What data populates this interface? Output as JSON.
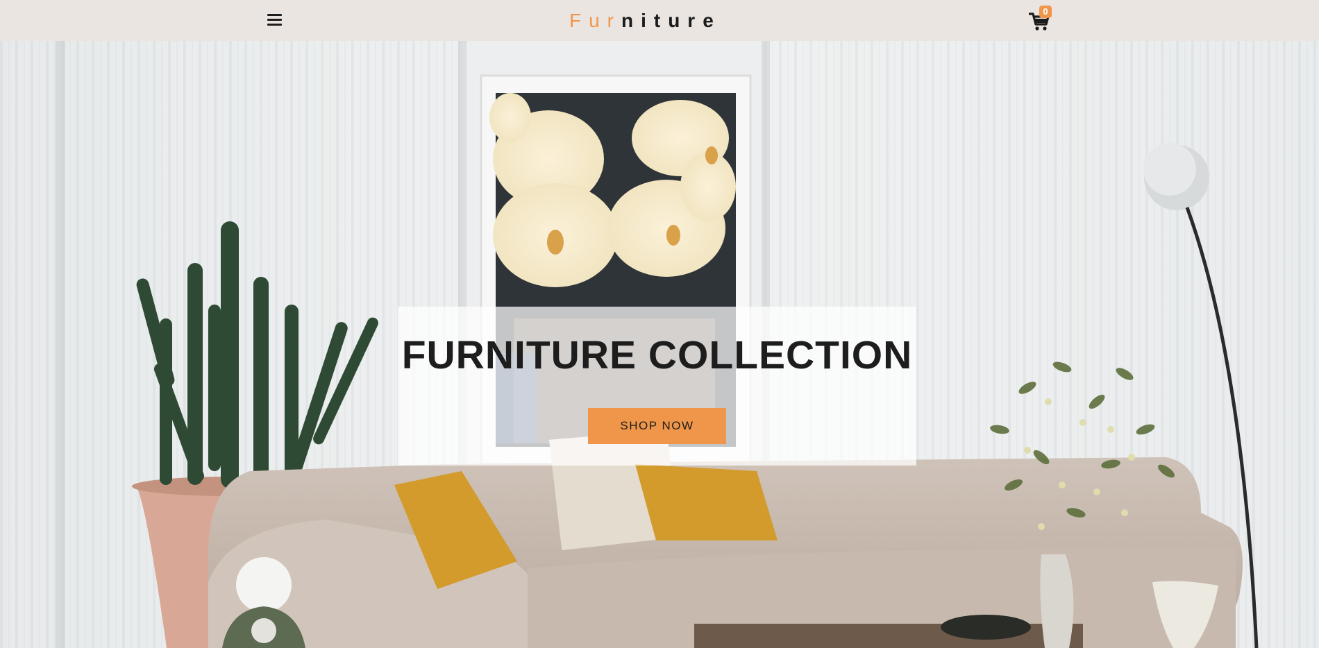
{
  "header": {
    "logo_accent": "Fur",
    "logo_rest": "niture",
    "cart_count": "0",
    "accent_color": "#f0964a",
    "icons": [
      "hamburger-menu-icon",
      "shopping-cart-icon"
    ]
  },
  "hero": {
    "title": "FURNITURE COLLECTION",
    "cta_label": "SHOP NOW"
  }
}
